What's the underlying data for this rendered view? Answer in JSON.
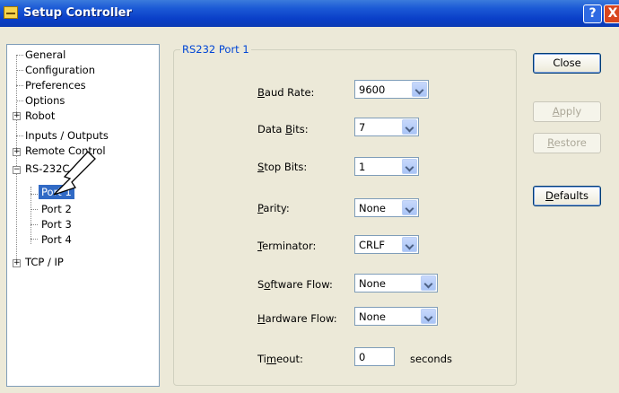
{
  "window": {
    "title": "Setup Controller",
    "help_button": "?",
    "close_button": "X"
  },
  "tree": {
    "items": [
      {
        "label": "General"
      },
      {
        "label": "Configuration"
      },
      {
        "label": "Preferences"
      },
      {
        "label": "Options"
      },
      {
        "label": "Robot"
      },
      {
        "label": "Inputs / Outputs"
      },
      {
        "label": "Remote Control"
      },
      {
        "label": "RS-232C"
      },
      {
        "label": "Port 1"
      },
      {
        "label": "Port 2"
      },
      {
        "label": "Port 3"
      },
      {
        "label": "Port 4"
      },
      {
        "label": "TCP / IP"
      }
    ],
    "expander_plus": "+",
    "expander_minus": "−",
    "selected": "Port 1"
  },
  "panel": {
    "title": "RS232 Port 1",
    "baud_rate": {
      "key": "B",
      "label_rest": "aud Rate:",
      "value": "9600"
    },
    "data_bits": {
      "label_pre": "Data ",
      "key": "B",
      "label_rest": "its:",
      "value": "7"
    },
    "stop_bits": {
      "key": "S",
      "label_rest": "top Bits:",
      "value": "1"
    },
    "parity": {
      "key": "P",
      "label_rest": "arity:",
      "value": "None"
    },
    "terminator": {
      "key": "T",
      "label_rest": "erminator:",
      "value": "CRLF"
    },
    "software_flow": {
      "label_pre": "S",
      "key": "o",
      "label_rest": "ftware Flow:",
      "value": "None"
    },
    "hardware_flow": {
      "key": "H",
      "label_rest": "ardware Flow:",
      "value": "None"
    },
    "timeout": {
      "label_pre": "Ti",
      "key": "m",
      "label_rest": "eout:",
      "value": "0",
      "unit": "seconds"
    }
  },
  "buttons": {
    "close": "Close",
    "apply": {
      "key": "A",
      "rest": "pply"
    },
    "restore": {
      "key": "R",
      "rest": "estore"
    },
    "defaults": {
      "key": "D",
      "rest": "efaults"
    }
  }
}
